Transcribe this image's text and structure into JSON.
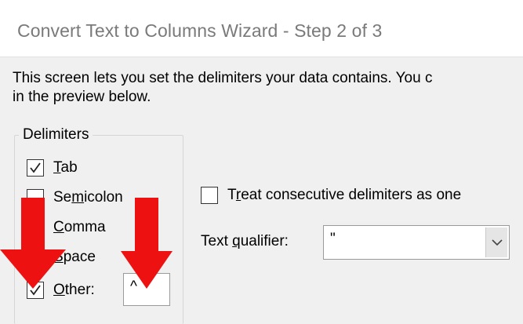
{
  "window": {
    "title": "Convert Text to Columns Wizard - Step 2 of 3"
  },
  "description": {
    "line1": "This screen lets you set the delimiters your data contains.  You c",
    "line2": "in the preview below."
  },
  "delimiters": {
    "group_label": "Delimiters",
    "items": [
      {
        "pre": "",
        "underlined": "T",
        "post": "ab",
        "checked": true
      },
      {
        "pre": "Se",
        "underlined": "m",
        "post": "icolon",
        "checked": false
      },
      {
        "pre": "",
        "underlined": "C",
        "post": "omma",
        "checked": false
      },
      {
        "pre": "",
        "underlined": "S",
        "post": "pace",
        "checked": false
      },
      {
        "pre": "",
        "underlined": "O",
        "post": "ther:",
        "checked": true
      }
    ],
    "other_value": "^"
  },
  "options": {
    "treat_pre": "T",
    "treat_underlined": "r",
    "treat_post": "eat consecutive delimiters as one",
    "treat_checked": false,
    "qualifier_pre": "Text ",
    "qualifier_underlined": "q",
    "qualifier_post": "ualifier:",
    "qualifier_value": "\""
  },
  "annotations": {
    "arrow_color": "#ee1111"
  }
}
